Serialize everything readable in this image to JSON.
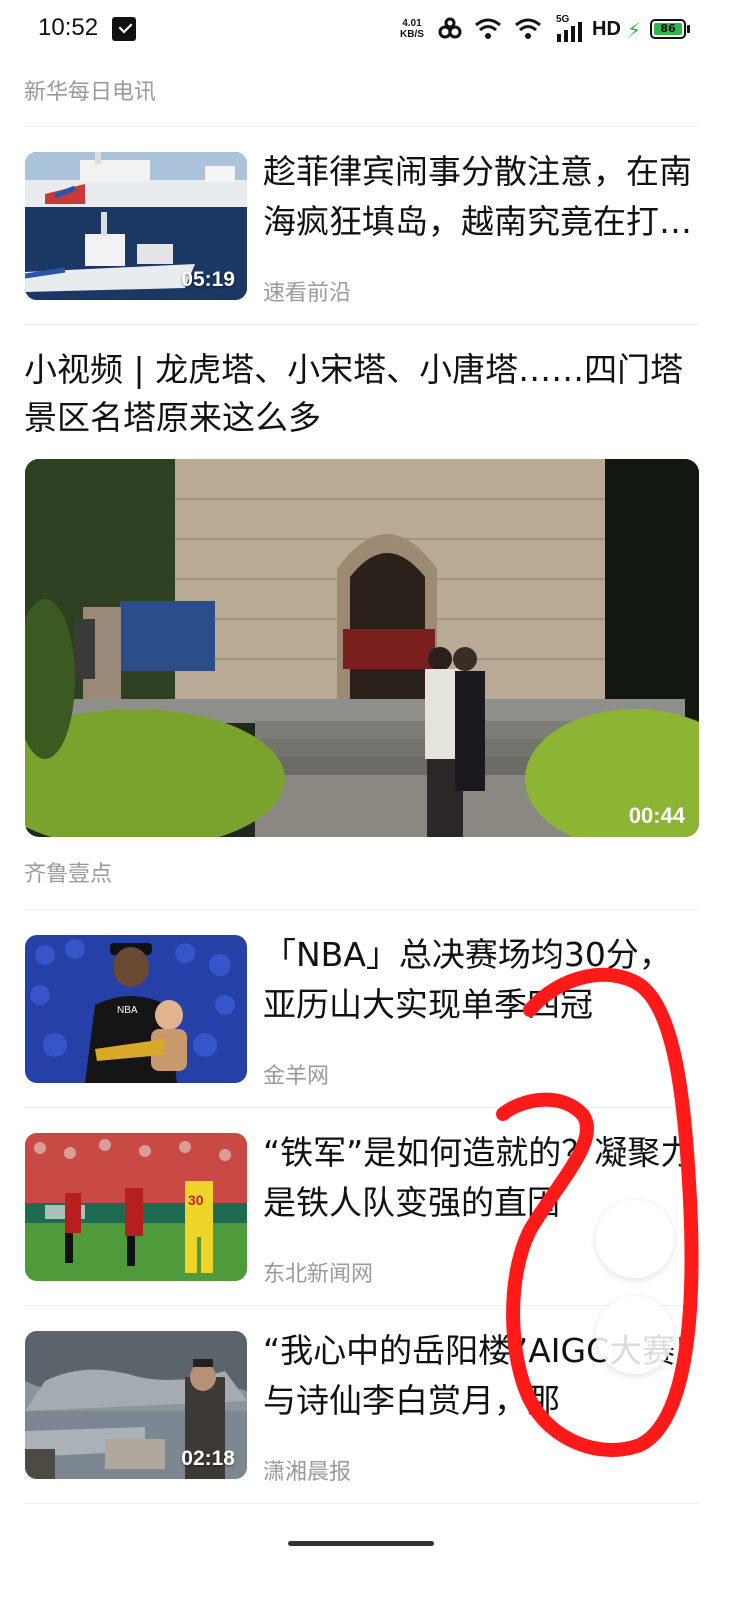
{
  "status_bar": {
    "time": "10:52",
    "speed_value": "4.01",
    "speed_unit": "KB/S",
    "network_label": "5G",
    "hd_label": "HD",
    "battery_level": "86",
    "battery_color": "#2fb54a"
  },
  "feed": {
    "top_source": "新华每日电讯",
    "articles": [
      {
        "title": "趁菲律宾闹事分散注意，在南海疯狂填岛，越南究竟在打什么算盘",
        "source": "速看前沿",
        "duration": "05:19"
      },
      {
        "title": "小视频 | 龙虎塔、小宋塔、小唐塔……四门塔景区名塔原来这么多",
        "source": "齐鲁壹点",
        "duration": "00:44"
      },
      {
        "title": "「NBA」总决赛场均30分，亚历山大实现单季四冠",
        "source": "金羊网",
        "duration": ""
      },
      {
        "title": "“铁军”是如何造就的？凝聚力是铁人队变强的直因",
        "source": "东北新闻网",
        "duration": ""
      },
      {
        "title": "“我心中的岳阳楼”AIGC大赛|与诗仙李白赏月，那",
        "source": "潇湘晨报",
        "duration": "02:18"
      }
    ]
  },
  "annotation_color": "#ff1a1a"
}
